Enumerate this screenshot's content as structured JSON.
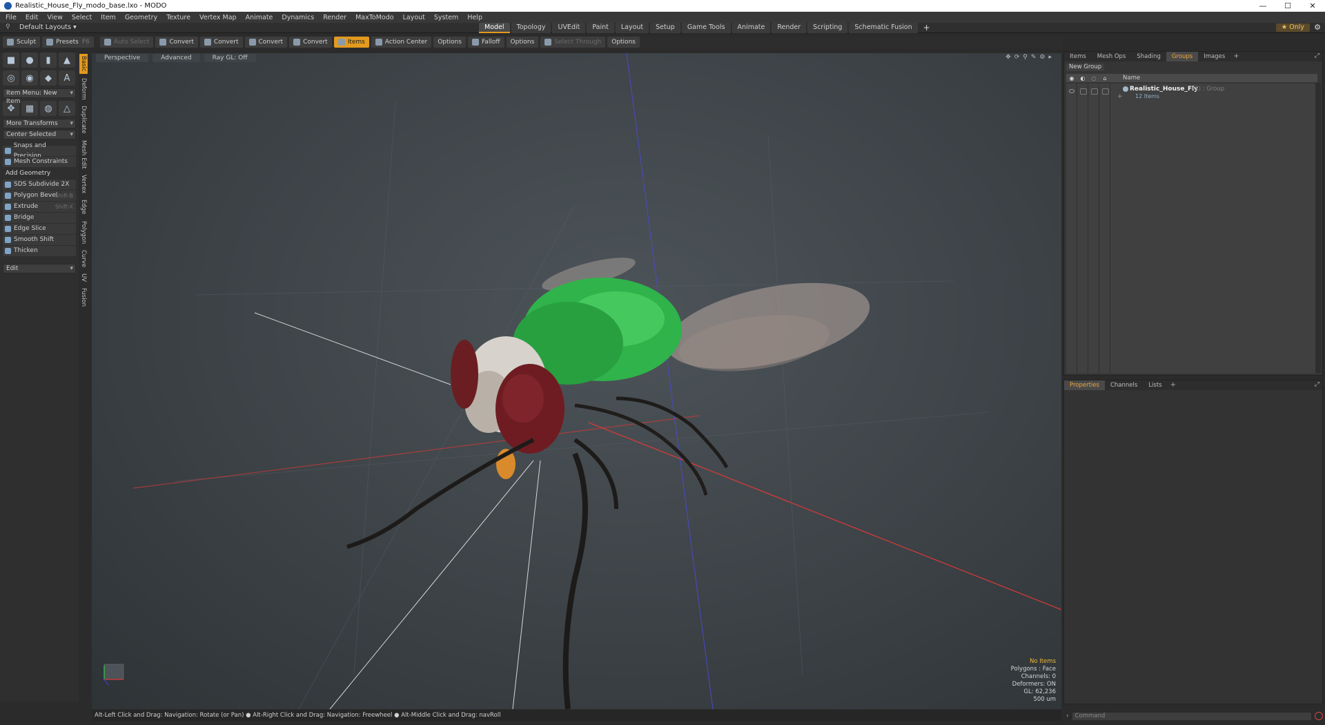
{
  "window": {
    "title": "Realistic_House_Fly_modo_base.lxo - MODO",
    "controls": [
      "—",
      "☐",
      "✕"
    ]
  },
  "menu": [
    "File",
    "Edit",
    "View",
    "Select",
    "Item",
    "Geometry",
    "Texture",
    "Vertex Map",
    "Animate",
    "Dynamics",
    "Render",
    "MaxToModo",
    "Layout",
    "System",
    "Help"
  ],
  "layouts": {
    "default_layouts": "Default Layouts ▾",
    "tabs": [
      "Model",
      "Topology",
      "UVEdit",
      "Paint",
      "Layout",
      "Setup",
      "Game Tools",
      "Animate",
      "Render",
      "Scripting",
      "Schematic Fusion"
    ],
    "active_tab": "Model",
    "plus": "+",
    "only": "★ Only"
  },
  "toolbar": {
    "sculpt": "Sculpt",
    "presets": "Presets",
    "presets_key": "F6",
    "auto_select": "Auto Select",
    "convert1": "Convert",
    "convert2": "Convert",
    "convert3": "Convert",
    "convert4": "Convert",
    "items": "Items",
    "action_center": "Action Center",
    "options1": "Options",
    "falloff": "Falloff",
    "options2": "Options",
    "select_through": "Select Through",
    "options3": "Options"
  },
  "toolbox": {
    "item_menu": "Item Menu: New Item",
    "more_transforms": "More Transforms",
    "center_selected": "Center Selected",
    "snaps": "Snaps and Precision",
    "mesh_constraints": "Mesh Constraints",
    "add_geometry": "Add Geometry",
    "tools": [
      {
        "label": "SDS Subdivide 2X",
        "key": ""
      },
      {
        "label": "Polygon Bevel",
        "key": "Shift-B"
      },
      {
        "label": "Extrude",
        "key": "Shift-X"
      },
      {
        "label": "Bridge",
        "key": ""
      },
      {
        "label": "Edge Slice",
        "key": ""
      },
      {
        "label": "Smooth Shift",
        "key": ""
      },
      {
        "label": "Thicken",
        "key": ""
      }
    ],
    "edit": "Edit",
    "vtabs": [
      "Basic",
      "Deform",
      "Duplicate",
      "Mesh Edit",
      "Vertex",
      "Edge",
      "Polygon",
      "Curve",
      "UV",
      "Fusion"
    ]
  },
  "viewport": {
    "view": "Perspective",
    "advanced": "Advanced",
    "raygl": "Ray GL: Off",
    "info": {
      "no_items": "No Items",
      "polygons": "Polygons : Face",
      "channels": "Channels: 0",
      "deformers": "Deformers: ON",
      "gl": "GL: 62,236",
      "scale": "500 um"
    }
  },
  "status": "Alt-Left Click and Drag: Navigation: Rotate (or Pan) ● Alt-Right Click and Drag: Navigation: Freewheel ● Alt-Middle Click and Drag: navRoll",
  "items_panel": {
    "tabs": [
      "Items",
      "Mesh Ops",
      "Shading",
      "Groups",
      "Images"
    ],
    "active_tab": "Groups",
    "new_group": "New Group",
    "column_name": "Name",
    "group_name": "Realistic_House_Fly",
    "group_type": "(2) : Group",
    "group_sub": "12 Items"
  },
  "props_panel": {
    "tabs": [
      "Properties",
      "Channels",
      "Lists"
    ],
    "active_tab": "Properties"
  },
  "command": {
    "placeholder": "Command"
  },
  "colors": {
    "accent": "#e39a1e",
    "fly_body": "#2fb34a",
    "fly_eye": "#6b1e22",
    "x_axis": "#c23a3a",
    "z_axis": "#4a4ac8"
  }
}
